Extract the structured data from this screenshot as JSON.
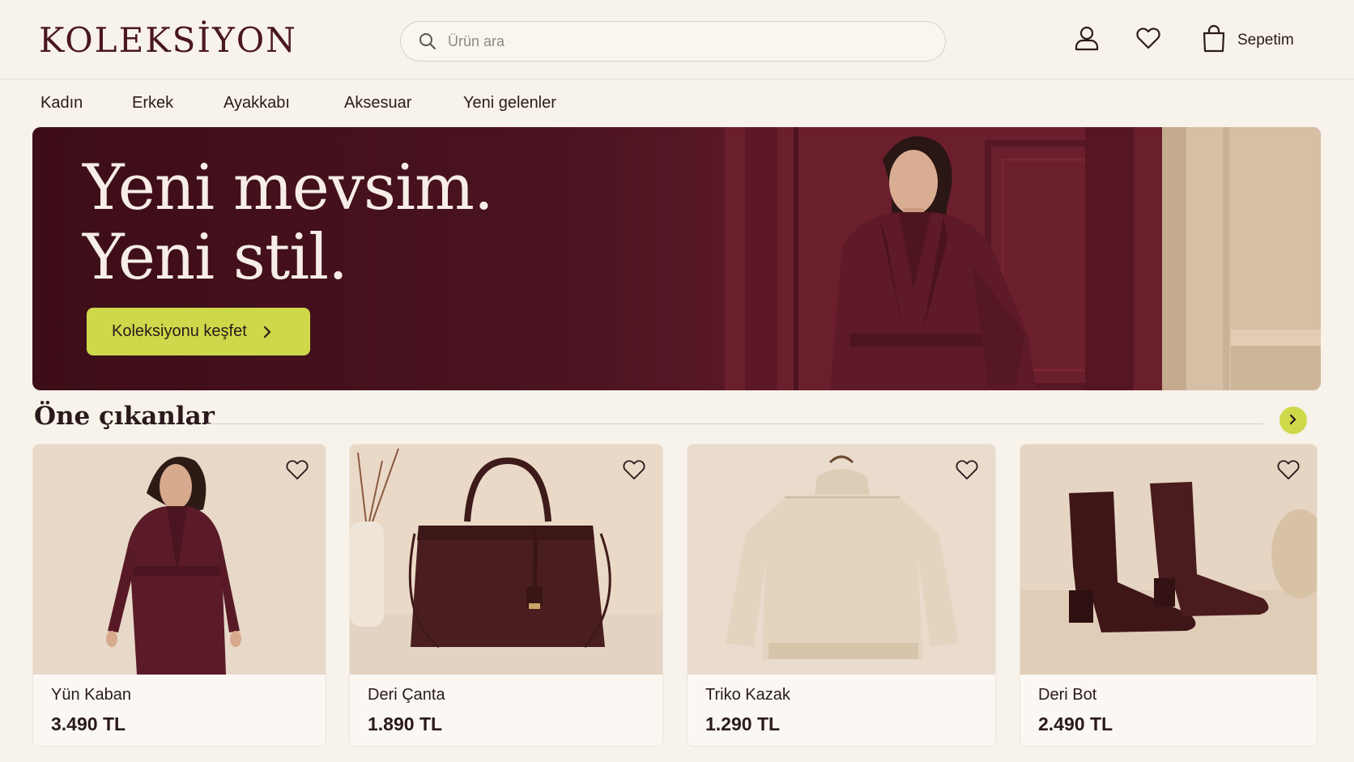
{
  "brand": {
    "logo": "KOLEKSİYON"
  },
  "search": {
    "placeholder": "Ürün ara"
  },
  "header": {
    "cart_label": "Sepetim"
  },
  "nav": [
    "Kadın",
    "Erkek",
    "Ayakkabı",
    "Aksesuar",
    "Yeni gelenler"
  ],
  "hero": {
    "title_line1": "Yeni mevsim.",
    "title_line2": "Yeni stil.",
    "cta": "Koleksiyonu keşfet"
  },
  "featured": {
    "title": "Öne çıkanlar",
    "products": [
      {
        "name": "Yün Kaban",
        "price": "3.490 TL"
      },
      {
        "name": "Deri Çanta",
        "price": "1.890 TL"
      },
      {
        "name": "Triko Kazak",
        "price": "1.290 TL"
      },
      {
        "name": "Deri Bot",
        "price": "2.490 TL"
      }
    ]
  },
  "colors": {
    "brand": "#4a1622",
    "accent": "#cdd94a",
    "hero_bg": "#4a1320",
    "background": "#f7f2ea"
  }
}
